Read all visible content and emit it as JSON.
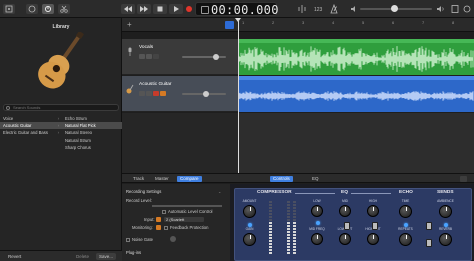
{
  "transport": {
    "time": "00:00.000",
    "buttons": [
      "rewind",
      "fast-forward",
      "stop",
      "play",
      "record",
      "cycle"
    ]
  },
  "library": {
    "title": "Library",
    "search_placeholder": "Search Sounds",
    "categories": [
      {
        "label": "Voice",
        "selected": false
      },
      {
        "label": "Acoustic Guitar",
        "selected": true
      },
      {
        "label": "Electric Guitar and Bass",
        "selected": false
      }
    ],
    "patches": [
      {
        "label": "Echo Strum",
        "selected": false
      },
      {
        "label": "Natural Flat Pick",
        "selected": true
      },
      {
        "label": "Natural Stereo",
        "selected": false
      },
      {
        "label": "Natural Strum",
        "selected": false
      },
      {
        "label": "Sharp Chorus",
        "selected": false
      }
    ],
    "footer": {
      "revert": "Revert",
      "delete": "Delete",
      "save": "Save..."
    }
  },
  "tracks": [
    {
      "name": "Vocals",
      "region_color": "#2f9e3d",
      "volume": 0.78
    },
    {
      "name": "Acoustic Guitar",
      "region_color": "#2d68c9",
      "volume": 0.55
    }
  ],
  "ruler": {
    "marks": [
      "1",
      "2",
      "3",
      "4",
      "5",
      "6",
      "7",
      "8"
    ]
  },
  "bottom_tabs": {
    "left": [
      "Track",
      "Master",
      "Compare"
    ],
    "center": [
      "Controls",
      "EQ"
    ],
    "active": [
      "Compare",
      "Controls"
    ]
  },
  "recording_settings": {
    "header": "Recording Settings",
    "record_level": "Record Level:",
    "auto_level": "Automatic Level Control",
    "input_label": "Input:",
    "input_value": "2 (Scarlett",
    "monitoring_label": "Monitoring:",
    "feedback": "Feedback Protection",
    "noise_gate": "Noise Gate",
    "plugins": "Plug-ins"
  },
  "amp": {
    "sections": [
      "COMPRESSOR",
      "EQ",
      "ECHO",
      "SENDS"
    ],
    "compressor_knobs": [
      "AMOUNT",
      "GAIN"
    ],
    "eq_knobs": [
      "LOW",
      "MID",
      "HIGH",
      "MID FREQ",
      "LOW CUT",
      "HIGH CUT"
    ],
    "echo_knobs": [
      "TIME",
      "REPEATS"
    ],
    "sends_knobs": [
      "AMBIENCE",
      "REVERB"
    ],
    "meter_level": 0.6
  }
}
